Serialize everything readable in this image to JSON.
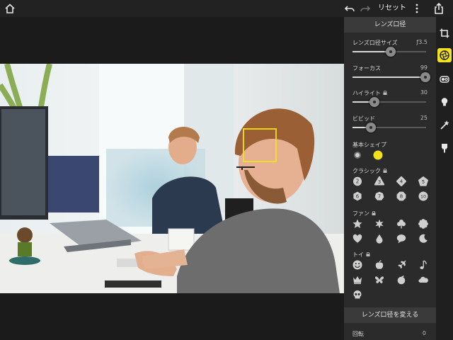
{
  "topbar": {
    "reset_label": "リセット"
  },
  "panel": {
    "title": "レンズ口径",
    "sliders": [
      {
        "label": "レンズ口径サイズ",
        "value": "ƒ3.5",
        "fraction": 0.52
      },
      {
        "label": "フォーカス",
        "value": "99",
        "fraction": 0.99
      },
      {
        "label": "ハイライト",
        "value": "30",
        "fraction": 0.3
      },
      {
        "label": "ビビッド",
        "value": "25",
        "fraction": 0.25
      }
    ],
    "basic_shape_label": "基本シェイプ",
    "classic_label": "クラシック",
    "classic_numbers": [
      "2",
      "3",
      "4",
      "5",
      "6",
      "7",
      "8",
      "10"
    ],
    "fun_label": "ファン",
    "toy_label": "トイ",
    "section2_title": "レンズ口径を変える",
    "rotation_label": "回転",
    "rotation_value": "0"
  },
  "colors": {
    "accent": "#f2e21e",
    "panel": "#2b2b2b",
    "topbar": "#222222"
  },
  "icons": [
    "home-icon",
    "undo-icon",
    "redo-icon",
    "more-icon",
    "share-icon",
    "crop-icon",
    "aperture-icon",
    "lens-icon",
    "bulb-icon",
    "wand-icon",
    "brush-icon",
    "lock-icon"
  ]
}
